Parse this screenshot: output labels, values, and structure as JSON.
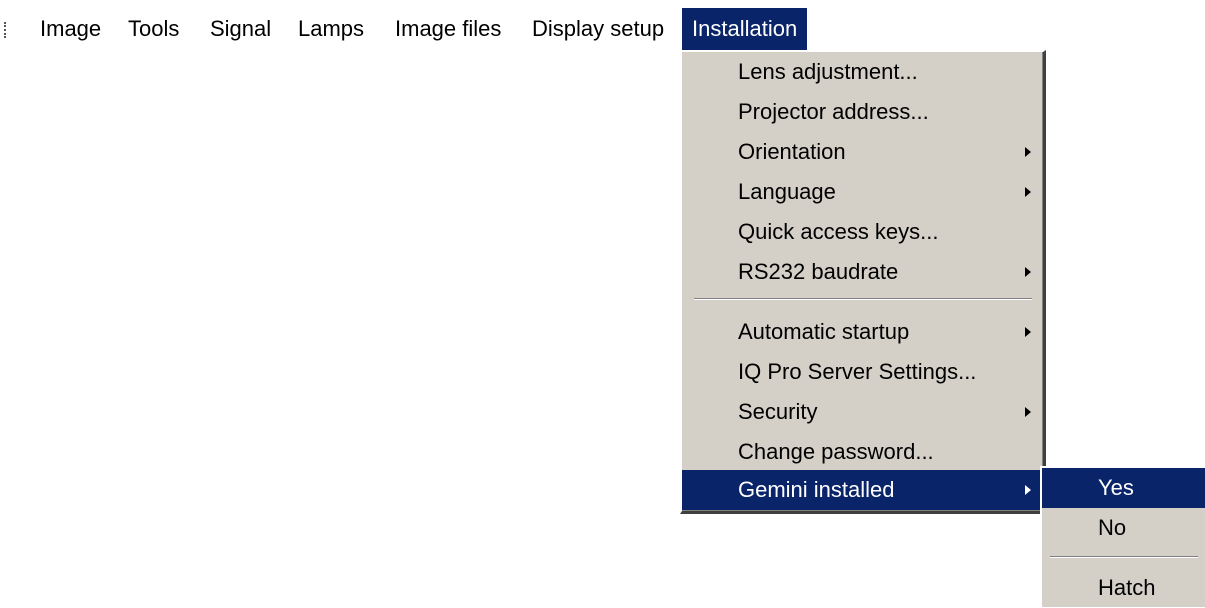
{
  "menubar": {
    "items": [
      {
        "label": "Image"
      },
      {
        "label": "Tools"
      },
      {
        "label": "Signal"
      },
      {
        "label": "Lamps"
      },
      {
        "label": "Image files"
      },
      {
        "label": "Display setup"
      },
      {
        "label": "Installation"
      }
    ],
    "active": "Installation"
  },
  "installation_menu": {
    "items": [
      {
        "label": "Lens adjustment...",
        "has_submenu": false
      },
      {
        "label": "Projector address...",
        "has_submenu": false
      },
      {
        "label": "Orientation",
        "has_submenu": true
      },
      {
        "label": "Language",
        "has_submenu": true
      },
      {
        "label": "Quick access keys...",
        "has_submenu": false
      },
      {
        "label": "RS232 baudrate",
        "has_submenu": true
      },
      {
        "label": "Automatic startup",
        "has_submenu": true
      },
      {
        "label": "IQ Pro Server Settings...",
        "has_submenu": false
      },
      {
        "label": "Security",
        "has_submenu": true
      },
      {
        "label": "Change password...",
        "has_submenu": false
      },
      {
        "label": "Gemini installed",
        "has_submenu": true,
        "highlighted": true
      }
    ]
  },
  "gemini_submenu": {
    "items": [
      {
        "label": "Yes",
        "highlighted": true
      },
      {
        "label": "No"
      },
      {
        "label": "Hatch"
      }
    ]
  },
  "colors": {
    "menu_background": "#d4d0c8",
    "highlight": "#0a246a",
    "highlight_text": "#ffffff"
  }
}
